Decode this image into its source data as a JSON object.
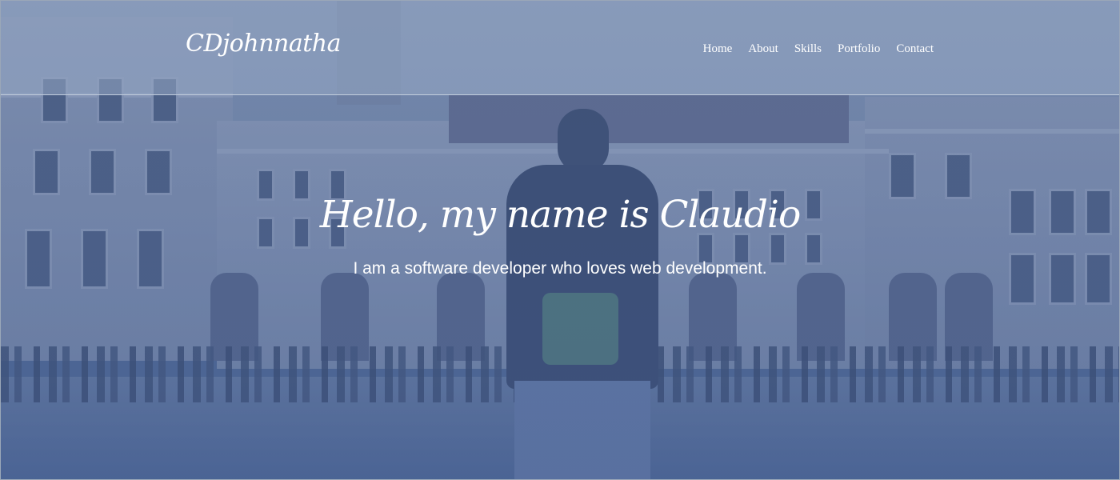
{
  "brand": {
    "name": "CDjohnnatha"
  },
  "nav": {
    "items": [
      {
        "label": "Home"
      },
      {
        "label": "About"
      },
      {
        "label": "Skills"
      },
      {
        "label": "Portfolio"
      },
      {
        "label": "Contact"
      }
    ]
  },
  "hero": {
    "title": "Hello, my name is Claudio",
    "subtitle": "I am a software developer who loves web development."
  },
  "colors": {
    "overlay": "#4f6791",
    "header_bg": "#96a8c4",
    "text": "#ffffff"
  }
}
